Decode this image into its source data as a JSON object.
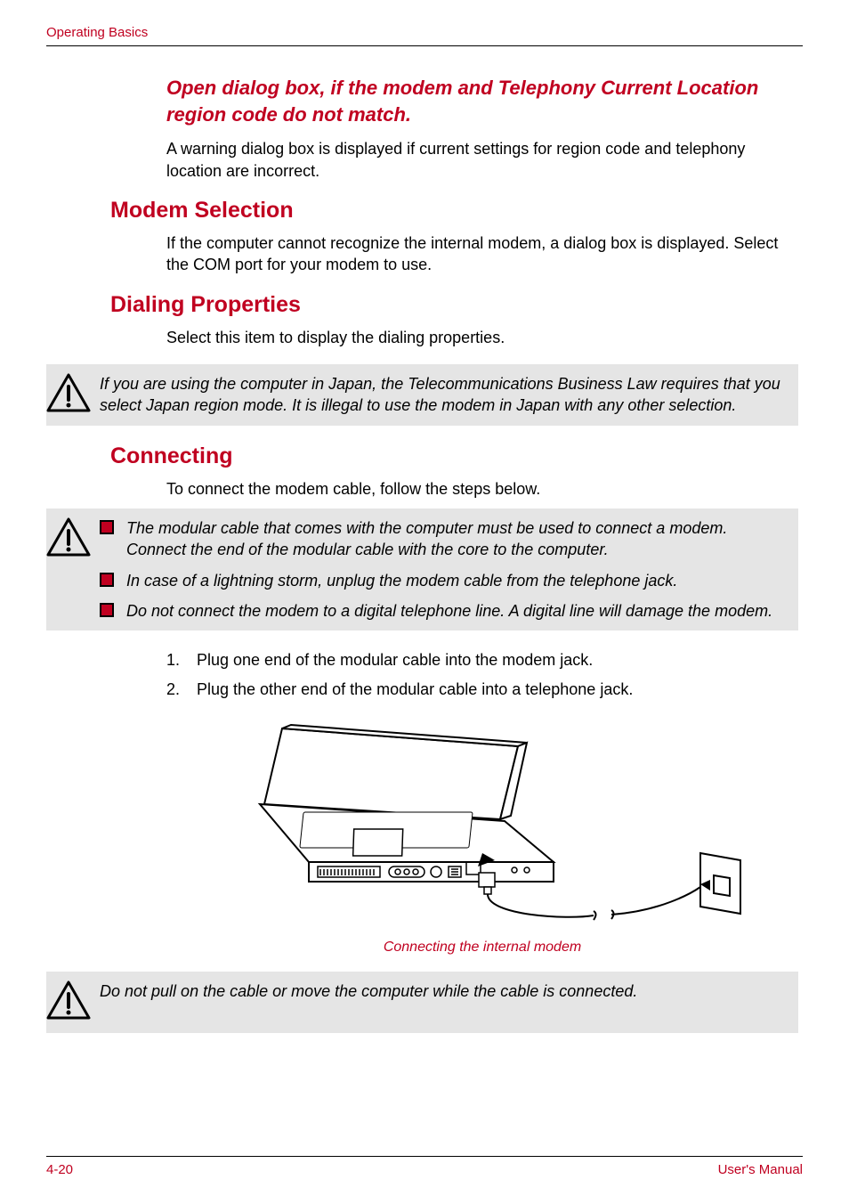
{
  "header": {
    "section_label": "Operating Basics"
  },
  "headings": {
    "open_dialog": "Open dialog box, if the modem and Telephony Current Location region code do not match.",
    "modem_selection": "Modem Selection",
    "dialing_properties": "Dialing Properties",
    "connecting": "Connecting"
  },
  "paragraphs": {
    "open_dialog_body": "A warning dialog box is displayed if current settings for region code and telephony location are incorrect.",
    "modem_selection_body": "If the computer cannot recognize the internal modem, a dialog box is displayed. Select the COM port for your modem to use.",
    "dialing_props_body": "Select this item to display the dialing properties.",
    "connecting_intro": "To connect the modem cable, follow the steps below."
  },
  "callouts": {
    "japan_law": "If you are using the computer in Japan, the Telecommunications Business Law requires that you select Japan region mode. It is illegal to use the modem in Japan with any other selection.",
    "connecting_bullets": [
      "The modular cable that comes with the computer must be used to connect a modem. Connect the end of the modular cable with the core to the computer.",
      "In case of a lightning storm, unplug the modem cable from the telephone jack.",
      "Do not connect the modem to a digital telephone line. A digital line will damage the modem."
    ],
    "no_pull": "Do not pull on the cable or move the computer while the cable is connected."
  },
  "steps": {
    "s1_num": "1.",
    "s1_text": "Plug one end of the modular cable into the modem jack.",
    "s2_num": "2.",
    "s2_text": "Plug the other end of the modular cable into a telephone jack."
  },
  "figure": {
    "caption": "Connecting the internal modem"
  },
  "footer": {
    "page_num": "4-20",
    "doc_title": "User's Manual"
  }
}
